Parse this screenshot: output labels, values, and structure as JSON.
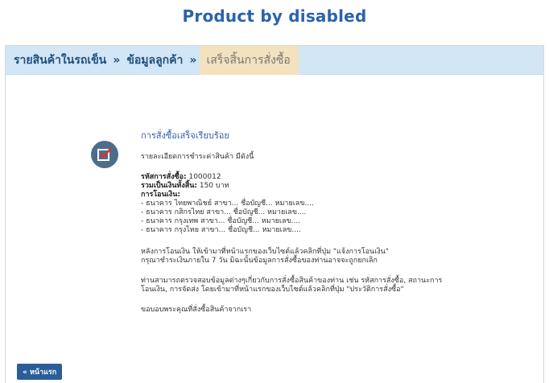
{
  "page": {
    "title": "Product by disabled"
  },
  "breadcrumb": {
    "items": [
      "รายสินค้าในรถเข็น",
      "ข้อมูลลูกค้า",
      "เสร็จสิ้นการสั่งซื้อ"
    ],
    "separator": "»"
  },
  "order": {
    "headline": "การสั่งซื้อเสร็จเรียบร้อย",
    "description": "รายละเอียดการชำระค่าสินค้า มีดังนี้",
    "order_no_label": "รหัสการสั่งซื้อ:",
    "order_no_value": "1000012",
    "total_label": "รวมเป็นเงินทั้งสิ้น:",
    "total_value": "150 บาท",
    "transfer_label": "การโอนเงิน:",
    "banks": [
      "- ธนาคาร ไทยพาณิชย์ สาขา... ชื่อบัญชี... หมายเลข....",
      "- ธนาคาร กสิกรไทย สาขา... ชื่อบัญชี... หมายเลข....",
      "- ธนาคาร กรุงเทพ สาขา... ชื่อบัญชี... หมายเลข....",
      "- ธนาคาร กรุงไทย สาขา... ชื่อบัญชี... หมายเลข...."
    ],
    "para1_line1": "หลังการโอนเงิน ให้เข้ามาที่หน้าแรกของเว็บไซต์แล้วคลิกที่ปุ่ม \"แจ้งการโอนเงิน\"",
    "para1_line2": "กรุณาชำระเงินภายใน 7 วัน มิฉะนั้นข้อมูลการสั่งซื้อของท่านอาจจะถูกยกเลิก",
    "para2_line1": "ท่านสามารถตรวจสอบข้อมูลต่างๆเกี่ยวกับการสั่งซื้อสินค้าของท่าน เช่น รหัสการสั่งซื้อ, สถานะการ",
    "para2_line2": "โอนเงิน, การจัดส่ง โดยเข้ามาที่หน้าแรกของเว็บไซต์แล้วคลิกที่ปุ่ม \"ประวัติการสั่งซื้อ\"",
    "thanks": "ขอบอบพระคุณที่สั่งซื้อสินค้าจากเรา"
  },
  "footer": {
    "home_button": "« หน้าแรก"
  },
  "colors": {
    "accent": "#2a63ad",
    "breadcrumb_bg": "#d3e6f6",
    "current_bg": "#f3e2bd",
    "icon_bg": "#4c6d8e"
  },
  "icons": {
    "status": "checkbox-check-icon"
  }
}
